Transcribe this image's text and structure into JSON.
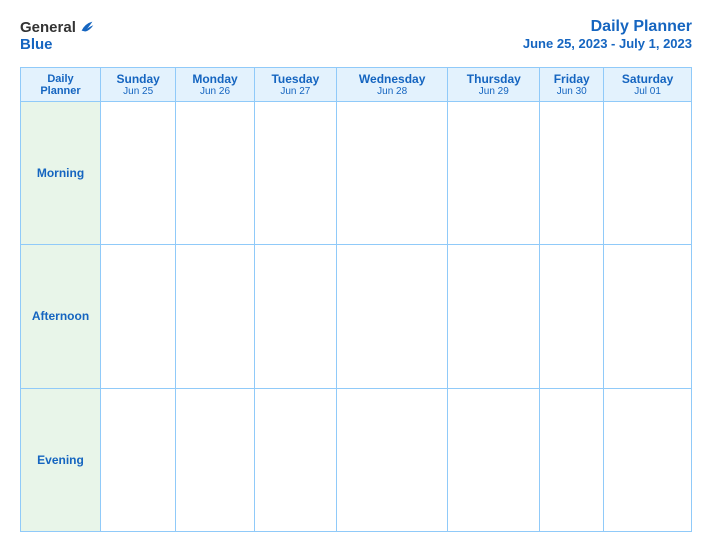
{
  "logo": {
    "general": "General",
    "blue": "Blue"
  },
  "header": {
    "title": "Daily Planner",
    "date_range": "June 25, 2023 - July 1, 2023"
  },
  "table": {
    "header_label_line1": "Daily",
    "header_label_line2": "Planner",
    "days": [
      {
        "name": "Sunday",
        "date": "Jun 25"
      },
      {
        "name": "Monday",
        "date": "Jun 26"
      },
      {
        "name": "Tuesday",
        "date": "Jun 27"
      },
      {
        "name": "Wednesday",
        "date": "Jun 28"
      },
      {
        "name": "Thursday",
        "date": "Jun 29"
      },
      {
        "name": "Friday",
        "date": "Jun 30"
      },
      {
        "name": "Saturday",
        "date": "Jul 01"
      }
    ],
    "rows": [
      {
        "label": "Morning"
      },
      {
        "label": "Afternoon"
      },
      {
        "label": "Evening"
      }
    ]
  }
}
